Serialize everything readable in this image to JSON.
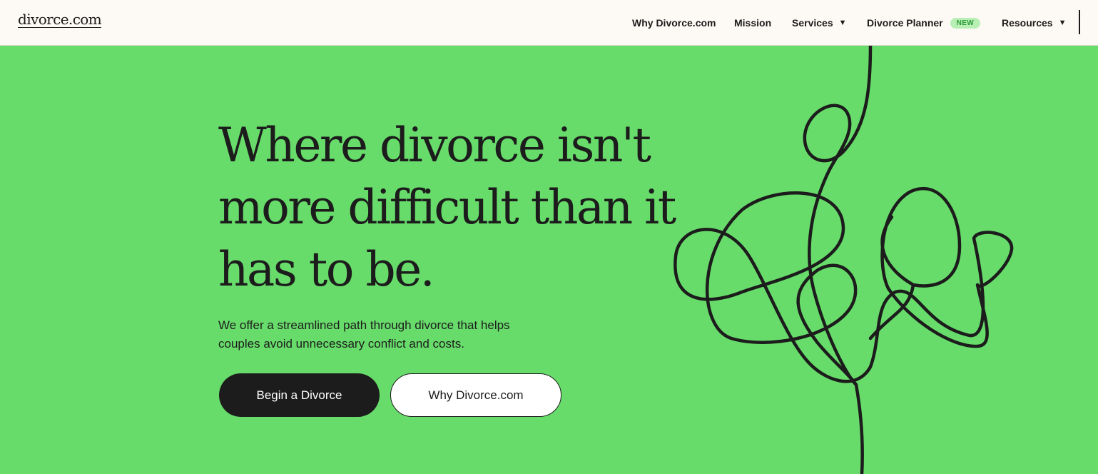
{
  "header": {
    "logo": "divorce.com",
    "nav": [
      {
        "label": "Why Divorce.com"
      },
      {
        "label": "Mission"
      },
      {
        "label": "Services",
        "icon": "caret-down-icon"
      },
      {
        "label": "Divorce Planner",
        "badge": "NEW"
      },
      {
        "label": "Resources",
        "icon": "caret-down-icon"
      }
    ]
  },
  "hero": {
    "title": "Where divorce isn't more difficult than it has to be.",
    "subtitle": "We offer a streamlined path through divorce that helps couples avoid unnecessary conflict and costs.",
    "primary_button": "Begin a Divorce",
    "secondary_button": "Why Divorce.com",
    "illustration": "tangled-line-icon"
  },
  "colors": {
    "background": "#68dc6b",
    "header_bg": "#fdf9f4",
    "text": "#1c1c1c",
    "primary_button_bg": "#1c1c1c",
    "badge_bg": "#b8efb4",
    "badge_text": "#2e9a3a"
  }
}
